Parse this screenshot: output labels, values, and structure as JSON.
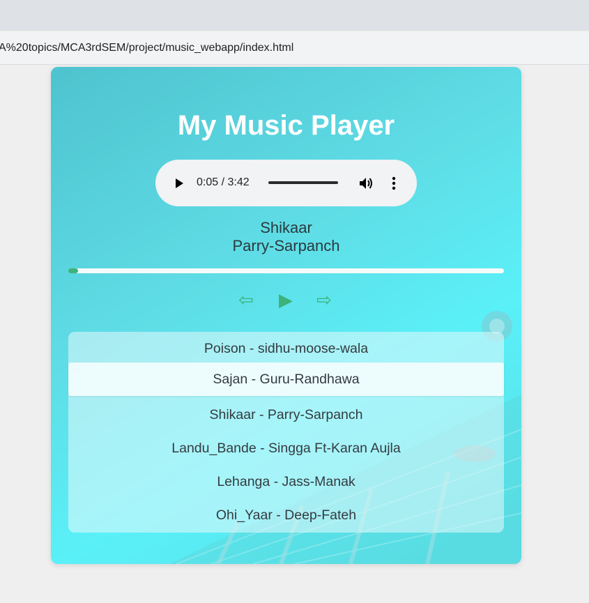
{
  "browser": {
    "url": "A%20topics/MCA3rdSEM/project/music_webapp/index.html"
  },
  "player": {
    "title": "My Music Player",
    "audio": {
      "time": "0:05 / 3:42",
      "play_icon": "play-icon",
      "volume_icon": "volume-icon",
      "more_icon": "more-vertical-icon"
    },
    "song": "Shikaar",
    "artist": "Parry-Sarpanch",
    "progress": 0.02,
    "controls": {
      "prev_icon": "⇦",
      "play_icon": "▶",
      "next_icon": "⇨"
    },
    "playlist": [
      {
        "label": "Poison - sidhu-moose-wala",
        "active": false
      },
      {
        "label": "Sajan - Guru-Randhawa",
        "active": true
      },
      {
        "label": "Shikaar - Parry-Sarpanch",
        "active": false
      },
      {
        "label": "Landu_Bande - Singga Ft-Karan Aujla",
        "active": false
      },
      {
        "label": "Lehanga - Jass-Manak",
        "active": false
      },
      {
        "label": "Ohi_Yaar - Deep-Fateh",
        "active": false
      }
    ]
  },
  "colors": {
    "accent": "#3cb37a",
    "card_gradient": [
      "#4ec3cf",
      "#5af0f8"
    ],
    "title_text": "#ffffff"
  }
}
